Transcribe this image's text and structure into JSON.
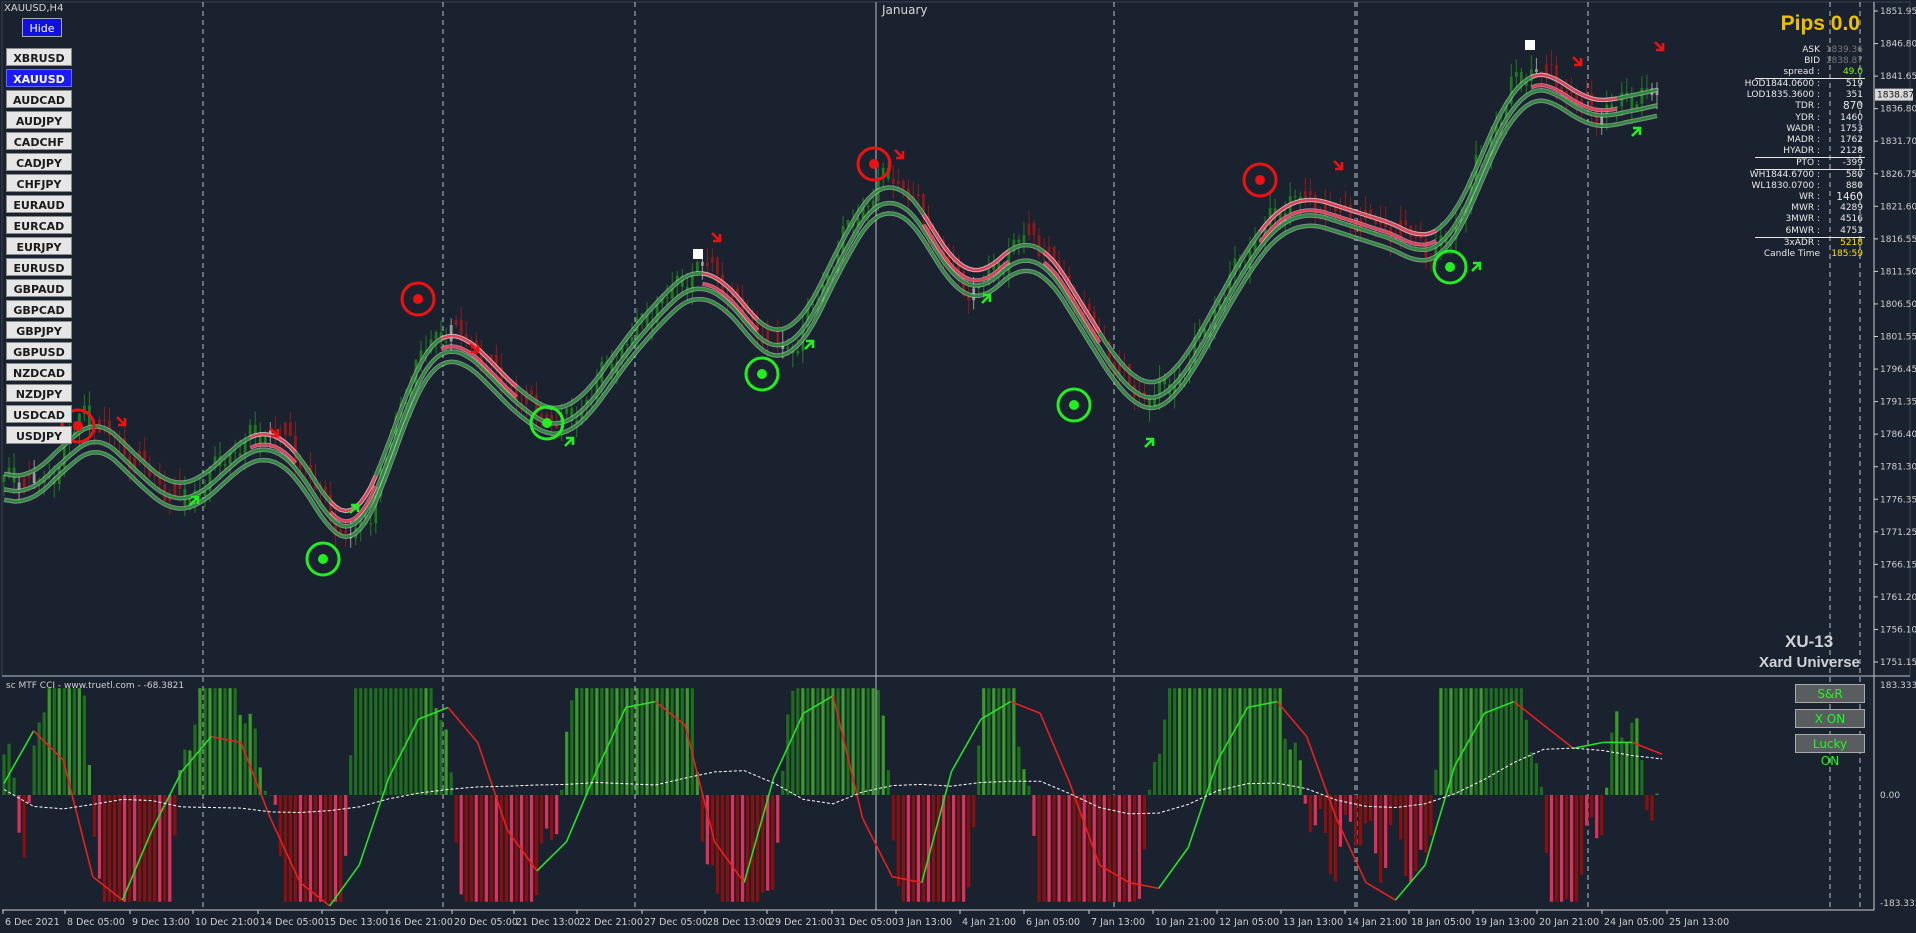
{
  "window": {
    "title": "XAUUSD,H4",
    "hide_label": "Hide",
    "month_label": "January"
  },
  "symbols": [
    "XBRUSD",
    "XAUUSD",
    "AUDCAD",
    "AUDJPY",
    "CADCHF",
    "CADJPY",
    "CHFJPY",
    "EURAUD",
    "EURCAD",
    "EURJPY",
    "EURUSD",
    "GBPAUD",
    "GBPCAD",
    "GBPJPY",
    "GBPUSD",
    "NZDCAD",
    "NZDJPY",
    "USDCAD",
    "USDJPY"
  ],
  "active_symbol": "XAUUSD",
  "info_panel": {
    "pips": "Pips 0.0",
    "ask_label": "ASK",
    "ask_value": "1839.36",
    "bid_label": "BID",
    "bid_value": "1838.87",
    "rows": [
      {
        "label": "spread :",
        "value": "49.0",
        "color": "green",
        "sep": false
      },
      {
        "label": "HOD1844.0600 :",
        "value": "519",
        "color": "",
        "sep": true
      },
      {
        "label": "LOD1835.3600 :",
        "value": "351",
        "color": "",
        "sep": false
      },
      {
        "label": "TDR :",
        "value": "870",
        "color": "big",
        "sep": false
      },
      {
        "label": "YDR :",
        "value": "1460",
        "color": "",
        "sep": false
      },
      {
        "label": "WADR :",
        "value": "1753",
        "color": "",
        "sep": false
      },
      {
        "label": "MADR :",
        "value": "1762",
        "color": "",
        "sep": false
      },
      {
        "label": "HYADR :",
        "value": "2128",
        "color": "",
        "sep": false
      },
      {
        "label": "PTO :",
        "value": "-399",
        "color": "",
        "sep": true
      },
      {
        "label": "WH1844.6700 :",
        "value": "580",
        "color": "",
        "sep": true
      },
      {
        "label": "WL1830.0700 :",
        "value": "880",
        "color": "",
        "sep": false
      },
      {
        "label": "WR :",
        "value": "1460",
        "color": "big",
        "sep": false
      },
      {
        "label": "MWR :",
        "value": "4289",
        "color": "",
        "sep": false
      },
      {
        "label": "3MWR :",
        "value": "4516",
        "color": "",
        "sep": false
      },
      {
        "label": "6MWR :",
        "value": "4753",
        "color": "",
        "sep": false
      },
      {
        "label": "3xADR :",
        "value": "5218",
        "color": "yellow",
        "sep": true
      },
      {
        "label": "Candle Time",
        "value": "185:59",
        "color": "yellow",
        "sep": false
      }
    ]
  },
  "brand": {
    "line1": "XU-13",
    "line2": "Xard Universe"
  },
  "indicator": {
    "label": "sc MTF CCI - www.truetl.com - -68.3821"
  },
  "toggles": [
    "S&R",
    "X ON",
    "Lucky ON"
  ],
  "current_price_label": "1838.87",
  "price_axis": [
    "1851.95",
    "1846.80",
    "1841.65",
    "1836.80",
    "1831.70",
    "1826.75",
    "1821.60",
    "1816.55",
    "1811.50",
    "1806.50",
    "1801.55",
    "1796.45",
    "1791.35",
    "1786.40",
    "1781.30",
    "1776.35",
    "1771.25",
    "1766.15",
    "1761.20",
    "1756.10",
    "1751.15"
  ],
  "cci_axis": [
    "183.3333",
    "0.00",
    "-183.3333"
  ],
  "time_axis": [
    "6 Dec 2021",
    "8 Dec 05:00",
    "9 Dec 13:00",
    "10 Dec 21:00",
    "14 Dec 05:00",
    "15 Dec 13:00",
    "16 Dec 21:00",
    "20 Dec 05:00",
    "21 Dec 13:00",
    "22 Dec 21:00",
    "27 Dec 05:00",
    "28 Dec 13:00",
    "29 Dec 21:00",
    "31 Dec 05:00",
    "3 Jan 13:00",
    "4 Jan 21:00",
    "6 Jan 05:00",
    "7 Jan 13:00",
    "10 Jan 21:00",
    "12 Jan 05:00",
    "13 Jan 13:00",
    "14 Jan 21:00",
    "18 Jan 05:00",
    "19 Jan 13:00",
    "20 Jan 21:00",
    "24 Jan 05:00",
    "25 Jan 13:00"
  ],
  "colors": {
    "background": "#1a2230",
    "bull": "#1f7a1f",
    "bear": "#8b1a1a",
    "neutral": "#9a9a9a",
    "ma_bull": "#2e8b3e",
    "ma_bear": "#e0405a",
    "signal_buy": "#22ee22",
    "signal_sell": "#ee1111"
  },
  "chart_data": {
    "type": "candlestick",
    "ylim": [
      1751.15,
      1851.95
    ],
    "approx_close_path": [
      1779,
      1780,
      1778,
      1784,
      1790,
      1787,
      1784,
      1781,
      1778,
      1776,
      1779,
      1783,
      1785,
      1787,
      1786,
      1781,
      1775,
      1770,
      1773,
      1783,
      1794,
      1800,
      1803,
      1801,
      1797,
      1794,
      1791,
      1789,
      1788,
      1792,
      1797,
      1801,
      1805,
      1808,
      1811,
      1813,
      1808,
      1804,
      1801,
      1799,
      1805,
      1812,
      1819,
      1823,
      1827,
      1823,
      1818,
      1812,
      1808,
      1811,
      1815,
      1818,
      1813,
      1808,
      1803,
      1798,
      1793,
      1792,
      1794,
      1799,
      1805,
      1811,
      1816,
      1820,
      1823,
      1822,
      1821,
      1820,
      1819,
      1818,
      1817,
      1814,
      1818,
      1827,
      1834,
      1841,
      1843,
      1841,
      1838,
      1836,
      1837,
      1839,
      1839
    ],
    "cci_ylim": [
      -183.3333,
      183.3333
    ],
    "cci_fast_line": [
      20,
      110,
      60,
      -140,
      -180,
      -60,
      40,
      100,
      90,
      -40,
      -150,
      -190,
      -120,
      30,
      130,
      150,
      90,
      -60,
      -130,
      -80,
      40,
      150,
      160,
      120,
      -80,
      -150,
      30,
      140,
      170,
      -40,
      -140,
      -150,
      40,
      130,
      160,
      140,
      20,
      -120,
      -150,
      -160,
      -90,
      60,
      150,
      160,
      100,
      -40,
      -150,
      -180,
      -120,
      50,
      140,
      160,
      120,
      80,
      90,
      90,
      70
    ]
  }
}
